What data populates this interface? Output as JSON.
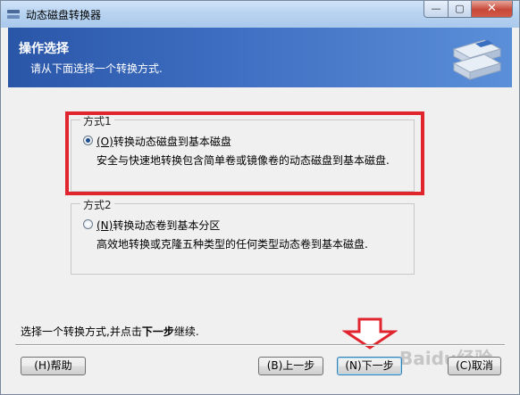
{
  "window": {
    "title": "动态磁盘转换器",
    "min_glyph": "—",
    "max_glyph": "▢",
    "close_glyph": "✕"
  },
  "banner": {
    "title": "操作选择",
    "subtitle": "请从下面选择一个转换方式."
  },
  "options": [
    {
      "group": "方式1",
      "mnemonic": "(O)",
      "label": "转换动态磁盘到基本磁盘",
      "description": "安全与快速地转换包含简单卷或镜像卷的动态磁盘到基本磁盘.",
      "selected": true
    },
    {
      "group": "方式2",
      "mnemonic": "(N)",
      "label": "转换动态卷到基本分区",
      "description": "高效地转换或克隆五种类型的任何类型动态卷到基本磁盘.",
      "selected": false
    }
  ],
  "status": {
    "prefix": "选择一个转换方式,并点击",
    "bold": "下一步",
    "suffix": "继续."
  },
  "buttons": {
    "help": "(H)帮助",
    "back": "(B)上一步",
    "next": "(N)下一步",
    "cancel": "(C)取消"
  },
  "watermark": "Baidu经验",
  "colors": {
    "banner": "#3f6fc2",
    "highlight_box": "#e1252f",
    "arrow": "#e1252f"
  }
}
